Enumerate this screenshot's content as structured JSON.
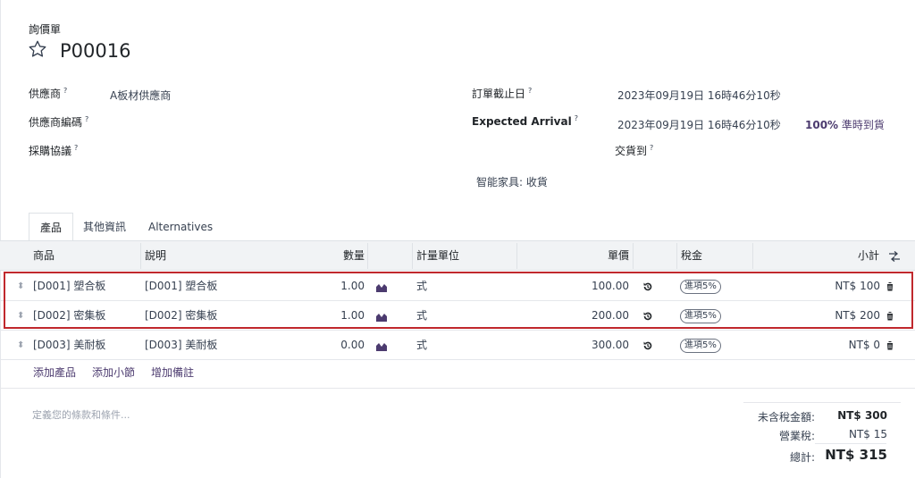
{
  "header": {
    "doc_type": "詢價單",
    "record_name": "P00016",
    "favorite_icon": "star-outline"
  },
  "left_fields": {
    "vendor_label": "供應商",
    "vendor_value": "A板材供應商",
    "vendor_ref_label": "供應商編碼",
    "agreement_label": "採購協議",
    "help_mark": "?"
  },
  "right_fields": {
    "deadline_label": "訂單截止日",
    "deadline_value": "2023年09月19日 16時46分10秒",
    "arrival_label": "Expected Arrival",
    "arrival_value": "2023年09月19日 16時46分10秒",
    "ontime_percent": "100%",
    "ontime_text": "準時到貨",
    "deliver_to_label": "交貨到",
    "deliver_to_value": "智能家具: 收貨"
  },
  "tabs": [
    {
      "label": "產品",
      "active": true
    },
    {
      "label": "其他資訊",
      "active": false
    },
    {
      "label": "Alternatives",
      "active": false
    }
  ],
  "table": {
    "headers": {
      "product": "商品",
      "description": "說明",
      "quantity": "數量",
      "uom": "計量單位",
      "unit_price": "單價",
      "taxes": "稅金",
      "subtotal": "小計"
    },
    "rows": [
      {
        "product": "[D001] 塑合板",
        "description": "[D001] 塑合板",
        "quantity": "1.00",
        "uom": "式",
        "unit_price": "100.00",
        "tax": "進項5%",
        "subtotal": "NT$ 100"
      },
      {
        "product": "[D002] 密集板",
        "description": "[D002] 密集板",
        "quantity": "1.00",
        "uom": "式",
        "unit_price": "200.00",
        "tax": "進項5%",
        "subtotal": "NT$ 200"
      },
      {
        "product": "[D003] 美耐板",
        "description": "[D003] 美耐板",
        "quantity": "0.00",
        "uom": "式",
        "unit_price": "300.00",
        "tax": "進項5%",
        "subtotal": "NT$ 0"
      }
    ],
    "actions": {
      "add_product": "添加產品",
      "add_section": "添加小節",
      "add_note": "增加備註"
    }
  },
  "terms_placeholder": "定義您的條款和條件...",
  "totals": {
    "untaxed_label": "未含稅金額:",
    "untaxed_value": "NT$ 300",
    "tax_label": "營業稅:",
    "tax_value": "NT$ 15",
    "total_label": "總計:",
    "total_value": "NT$ 315"
  },
  "colors": {
    "accent": "#4c3b6f",
    "selection_border": "#c0282d",
    "header_bg": "#f1f3f5"
  }
}
